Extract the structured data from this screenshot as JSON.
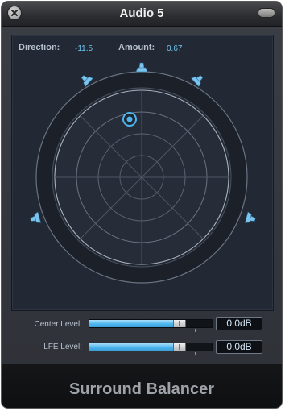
{
  "window": {
    "title": "Audio 5"
  },
  "surround": {
    "direction_label": "Direction:",
    "direction_value": "-11.5",
    "amount_label": "Amount:",
    "amount_value": "0.67",
    "speakers": [
      "left-front",
      "center",
      "right-front",
      "left-surround",
      "right-surround"
    ]
  },
  "levels": {
    "center_label": "Center Level:",
    "center_value": "0.0dB",
    "center_fraction": 0.75,
    "lfe_label": "LFE Level:",
    "lfe_value": "0.0dB",
    "lfe_fraction": 0.75
  },
  "footer": {
    "plugin_name": "Surround Balancer"
  },
  "colors": {
    "accent": "#4fb4ec",
    "panel": "#232934",
    "ring": "#1a1f27"
  }
}
